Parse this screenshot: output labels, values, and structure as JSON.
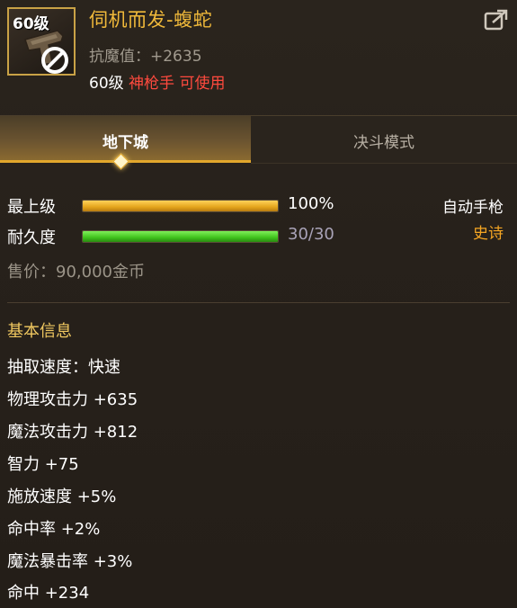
{
  "item": {
    "level_badge": "60级",
    "name": "伺机而发-蝮蛇",
    "stat_line": "抗魔值：+2635",
    "req_level": "60级",
    "req_class": "神枪手 可使用"
  },
  "tabs": [
    {
      "label": "地下城",
      "active": true
    },
    {
      "label": "决斗模式",
      "active": false
    }
  ],
  "grade": {
    "label": "最上级",
    "value": "100%",
    "fill": 1.0
  },
  "durability": {
    "label": "耐久度",
    "value": "30/30",
    "fill": 1.0
  },
  "weapon_type": "自动手枪",
  "rarity": "史诗",
  "price": "售价：90,000金币",
  "basic_info": {
    "title": "基本信息",
    "attributes": [
      "抽取速度：快速",
      "物理攻击力 +635",
      "魔法攻击力 +812",
      "智力 +75",
      "施放速度 +5%",
      "命中率 +2%",
      "魔法暴击率 +3%",
      "命中 +234"
    ]
  },
  "colors": {
    "name": "#f0b93a",
    "rarity": "#f5a623",
    "class_req": "#ff4a3e",
    "section_title": "#f0c860",
    "tab_active_border": "#e2a72c"
  },
  "icons": {
    "share": "share-icon",
    "ban": "no-use-icon",
    "item": "gun-icon"
  }
}
